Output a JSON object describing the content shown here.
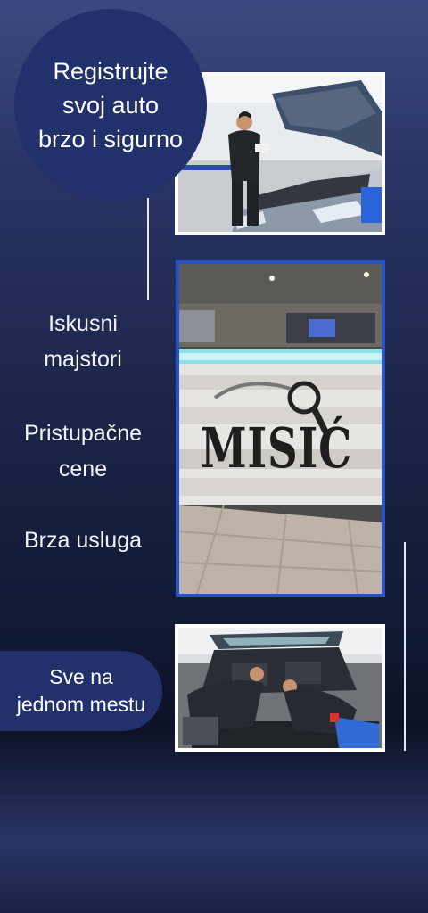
{
  "badge": {
    "line1": "Registrujte",
    "line2": "svoj auto",
    "line3": "brzo i sigurno"
  },
  "features": [
    {
      "line1": "Iskusni",
      "line2": "majstori"
    },
    {
      "line1": "Pristupačne",
      "line2": "cene"
    },
    {
      "line1": "Brza usluga",
      "line2": ""
    }
  ],
  "pill": {
    "line1": "Sve na",
    "line2": "jednom mestu"
  },
  "sign_text": "MISIĆ",
  "colors": {
    "navy": "#22306b",
    "photo_frame_blue": "#2a52c8",
    "white": "#ffffff"
  }
}
